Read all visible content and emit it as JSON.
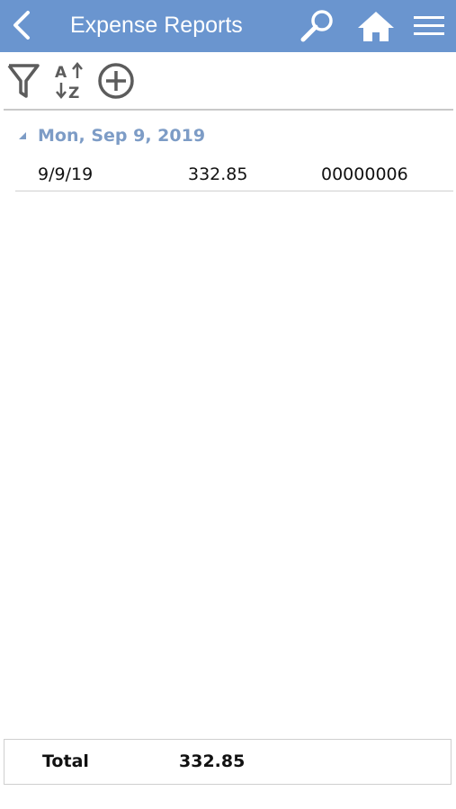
{
  "colors": {
    "accent": "#6a95cf",
    "group_label": "#7d9cc6",
    "toolbar_icon": "#5c5c5c"
  },
  "header": {
    "title": "Expense Reports",
    "icons": {
      "back": "chevron-left-icon",
      "search": "search-icon",
      "home": "home-icon",
      "menu": "hamburger-menu-icon"
    }
  },
  "toolbar": {
    "icons": [
      "filter-icon",
      "sort-az-icon",
      "add-circle-icon"
    ]
  },
  "groups": [
    {
      "label": "Mon, Sep 9, 2019",
      "expanded": true,
      "rows": [
        {
          "date": "9/9/19",
          "amount": "332.85",
          "id": "00000006"
        }
      ]
    }
  ],
  "footer": {
    "total_label": "Total",
    "total_value": "332.85"
  }
}
